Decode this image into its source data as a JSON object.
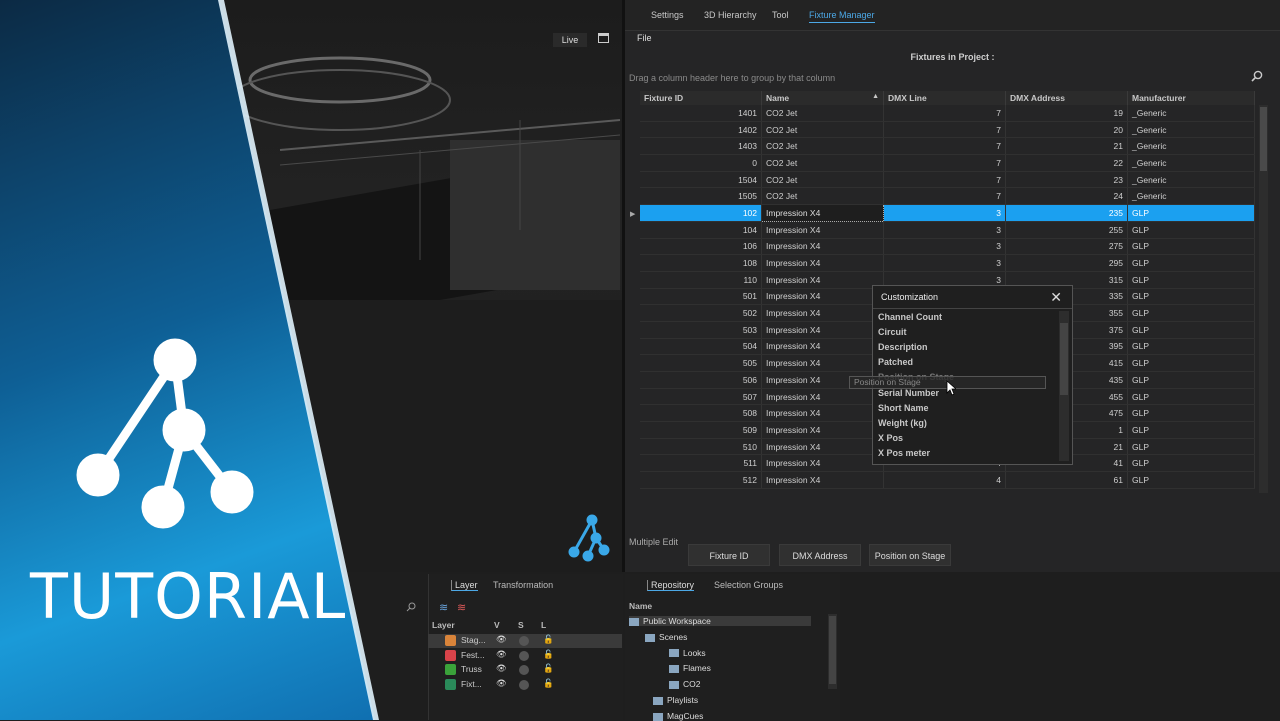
{
  "viewport": {
    "live_label": "Live"
  },
  "banner": {
    "title": "TUTORIAL"
  },
  "top_tabs": [
    "Settings",
    "3D Hierarchy",
    "Tool",
    "Fixture Manager"
  ],
  "menu": {
    "file": "File"
  },
  "fixtures": {
    "title": "Fixtures in Project :",
    "group_hint": "Drag a column header here to group by that column",
    "columns": [
      "Fixture ID",
      "Name",
      "DMX Line",
      "DMX Address",
      "Manufacturer"
    ],
    "rows": [
      [
        "1401",
        "CO2 Jet",
        "7",
        "19",
        "_Generic"
      ],
      [
        "1402",
        "CO2 Jet",
        "7",
        "20",
        "_Generic"
      ],
      [
        "1403",
        "CO2 Jet",
        "7",
        "21",
        "_Generic"
      ],
      [
        "0",
        "CO2 Jet",
        "7",
        "22",
        "_Generic"
      ],
      [
        "1504",
        "CO2 Jet",
        "7",
        "23",
        "_Generic"
      ],
      [
        "1505",
        "CO2 Jet",
        "7",
        "24",
        "_Generic"
      ],
      [
        "102",
        "Impression X4",
        "3",
        "235",
        "GLP"
      ],
      [
        "104",
        "Impression X4",
        "3",
        "255",
        "GLP"
      ],
      [
        "106",
        "Impression X4",
        "3",
        "275",
        "GLP"
      ],
      [
        "108",
        "Impression X4",
        "3",
        "295",
        "GLP"
      ],
      [
        "110",
        "Impression X4",
        "3",
        "315",
        "GLP"
      ],
      [
        "501",
        "Impression X4",
        "",
        "335",
        "GLP"
      ],
      [
        "502",
        "Impression X4",
        "",
        "355",
        "GLP"
      ],
      [
        "503",
        "Impression X4",
        "",
        "375",
        "GLP"
      ],
      [
        "504",
        "Impression X4",
        "",
        "395",
        "GLP"
      ],
      [
        "505",
        "Impression X4",
        "",
        "415",
        "GLP"
      ],
      [
        "506",
        "Impression X4",
        "",
        "435",
        "GLP"
      ],
      [
        "507",
        "Impression X4",
        "",
        "455",
        "GLP"
      ],
      [
        "508",
        "Impression X4",
        "",
        "475",
        "GLP"
      ],
      [
        "509",
        "Impression X4",
        "",
        "1",
        "GLP"
      ],
      [
        "510",
        "Impression X4",
        "",
        "21",
        "GLP"
      ],
      [
        "511",
        "Impression X4",
        "4",
        "41",
        "GLP"
      ],
      [
        "512",
        "Impression X4",
        "4",
        "61",
        "GLP"
      ]
    ],
    "selected_row": 6,
    "multiple_edit_label": "Multiple Edit",
    "buttons": [
      "Fixture ID",
      "DMX Address",
      "Position on Stage"
    ]
  },
  "customization": {
    "title": "Customization",
    "items": [
      "Channel Count",
      "Circuit",
      "Description",
      "Patched",
      "Position on Stage",
      "Serial Number",
      "Short Name",
      "Weight (kg)",
      "X Pos",
      "X Pos meter"
    ],
    "drag_ghost": "Position on Stage"
  },
  "layers": {
    "tabs": [
      "Layer",
      "Transformation"
    ],
    "headers": [
      "Layer",
      "V",
      "S",
      "L"
    ],
    "rows": [
      {
        "name": "Stag...",
        "color": "#d9843a"
      },
      {
        "name": "Fest...",
        "color": "#d9434a"
      },
      {
        "name": "Truss",
        "color": "#3aa23a"
      },
      {
        "name": "Fixt...",
        "color": "#2a8a5a"
      }
    ]
  },
  "repository": {
    "tabs": [
      "Repository",
      "Selection Groups"
    ],
    "header": "Name",
    "items": [
      "Public Workspace",
      "Scenes",
      "Looks",
      "Flames",
      "CO2",
      "Playlists",
      "MagCues"
    ]
  }
}
